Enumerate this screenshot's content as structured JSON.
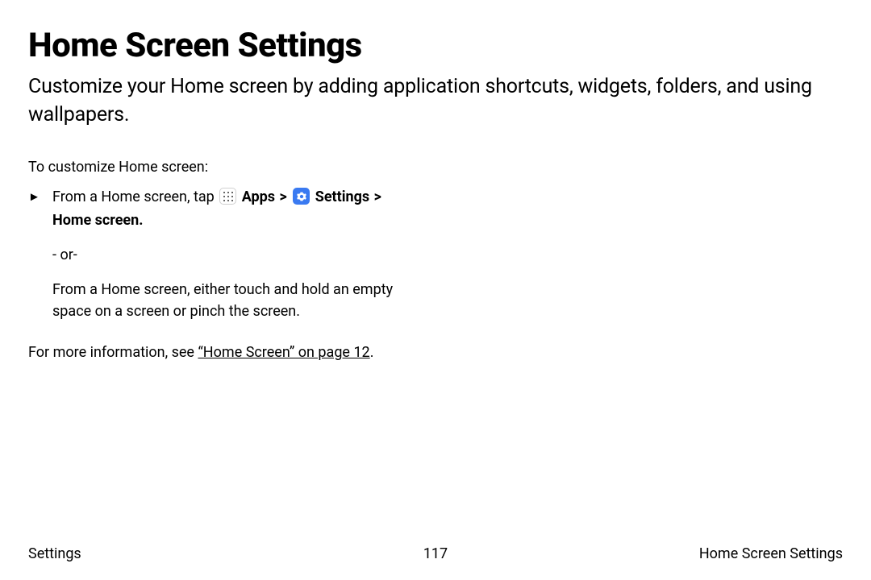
{
  "title": "Home Screen Settings",
  "intro": "Customize your Home screen by adding application shortcuts, widgets, folders, and using wallpapers.",
  "body": {
    "lead": "To customize Home screen:",
    "marker": "►",
    "step_prefix": "From a Home screen, tap ",
    "apps_label": "Apps",
    "chevron": ">",
    "settings_label": "Settings",
    "cont_label": "Home screen",
    "period": ".",
    "or_label": "- or-",
    "alt_text": "From a Home screen, either touch and hold an empty space on a screen or pinch the screen.",
    "more_prefix": "For more information, see ",
    "xref_label": "“Home Screen” on page 12",
    "more_suffix": "."
  },
  "footer": {
    "left": "Settings",
    "page": "117",
    "right": "Home Screen Settings"
  }
}
